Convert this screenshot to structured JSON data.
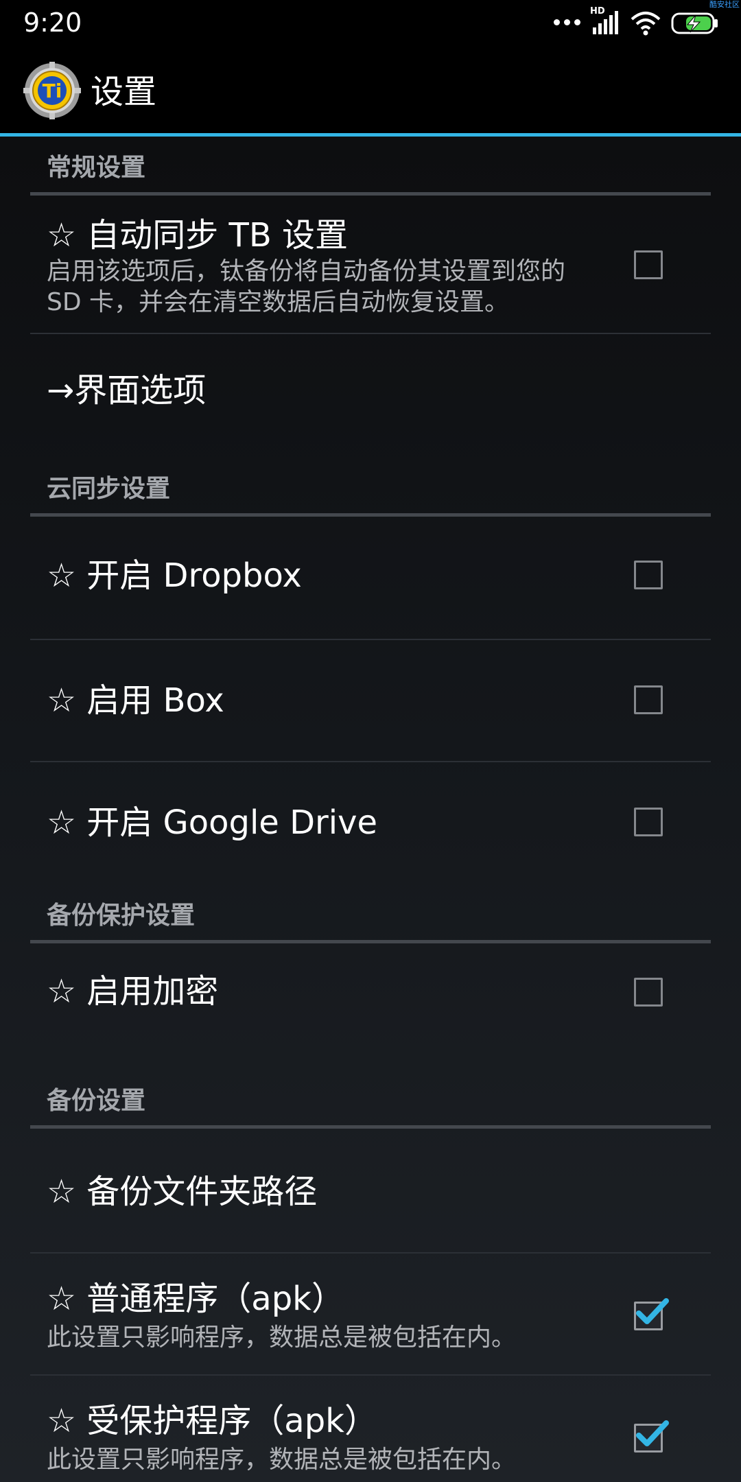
{
  "status_bar": {
    "time": "9:20",
    "network_label": "HD",
    "watermark": "酷安社区",
    "icons": [
      "more-dots-icon",
      "signal-icon",
      "wifi-icon",
      "battery-charging-icon"
    ]
  },
  "toolbar": {
    "title": "设置",
    "app_icon": "titanium-backup-icon",
    "app_icon_text": "Ti"
  },
  "colors": {
    "accent": "#33b5e5",
    "background": "#000000",
    "section_text": "#a5a8ad",
    "summary_text": "#b2b4b8",
    "check_blue": "#33b5e5"
  },
  "sections": [
    {
      "header": "常规设置",
      "items": [
        {
          "title": "☆ 自动同步 TB 设置",
          "summary": "启用该选项后，钛备份将自动备份其设置到您的 SD 卡，并会在清空数据后自动恢复设置。",
          "checkbox": false
        },
        {
          "title": "→界面选项"
        }
      ]
    },
    {
      "header": "云同步设置",
      "items": [
        {
          "title": "☆ 开启 Dropbox",
          "checkbox": false
        },
        {
          "title": "☆ 启用 Box",
          "checkbox": false
        },
        {
          "title": "☆ 开启 Google Drive",
          "checkbox": false
        }
      ]
    },
    {
      "header": "备份保护设置",
      "items": [
        {
          "title": "☆ 启用加密",
          "checkbox": false
        }
      ]
    },
    {
      "header": "备份设置",
      "items": [
        {
          "title": "☆ 备份文件夹路径"
        },
        {
          "title": "☆ 普通程序（apk）",
          "summary": "此设置只影响程序，数据总是被包括在内。",
          "checkbox": true
        },
        {
          "title": "☆ 受保护程序（apk）",
          "summary": "此设置只影响程序，数据总是被包括在内。",
          "checkbox": true
        }
      ]
    }
  ]
}
